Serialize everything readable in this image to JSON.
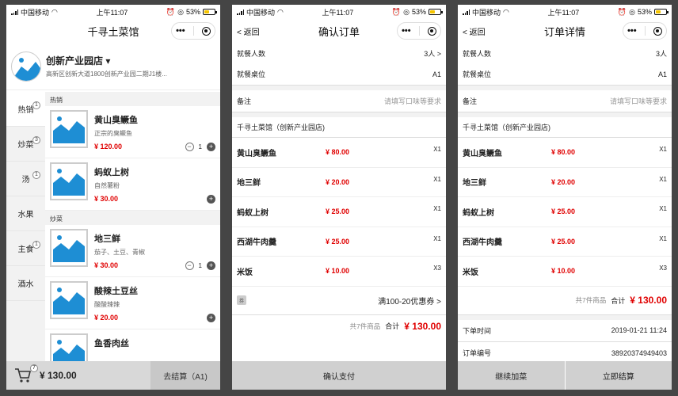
{
  "status": {
    "carrier": "中国移动",
    "time": "上午11:07",
    "battery": "53%",
    "battery_level": 0.53
  },
  "capsule": {
    "more": "•••"
  },
  "colors": {
    "price": "#e00000",
    "background": "#454545",
    "bar": "#d0d0d0"
  },
  "panel1": {
    "title": "千寻土菜馆",
    "store_name": "创新产业园店",
    "store_address": "高新区创新大道1800创新产业园二期J1楼...",
    "categories": [
      {
        "label": "热销",
        "badge": "1"
      },
      {
        "label": "炒菜",
        "badge": "3"
      },
      {
        "label": "汤",
        "badge": "1"
      },
      {
        "label": "水果",
        "badge": ""
      },
      {
        "label": "主食",
        "badge": "1"
      },
      {
        "label": "酒水",
        "badge": ""
      }
    ],
    "sections": [
      {
        "title": "热销",
        "items": [
          {
            "name": "黄山臭鳜鱼",
            "desc": "正宗的臭鳜鱼",
            "price": "¥ 120.00",
            "qty": "1"
          },
          {
            "name": "蚂蚁上树",
            "desc": "自然薯粉",
            "price": "¥ 30.00",
            "qty": ""
          }
        ]
      },
      {
        "title": "炒菜",
        "items": [
          {
            "name": "地三鲜",
            "desc": "茄子、土豆、青椒",
            "price": "¥ 30.00",
            "qty": "1"
          },
          {
            "name": "酸辣土豆丝",
            "desc": "酸酸辣辣",
            "price": "¥ 20.00",
            "qty": ""
          },
          {
            "name": "鱼香肉丝",
            "desc": "",
            "price": "",
            "qty": ""
          }
        ]
      }
    ],
    "cart": {
      "badge": "7",
      "amount": "¥ 130.00",
      "checkout": "去结算（A1)"
    }
  },
  "panel2": {
    "back": "< 返回",
    "title": "确认订单",
    "diners_label": "就餐人数",
    "diners_value": "3人 >",
    "table_label": "就餐桌位",
    "table_value": "A1",
    "remark_label": "备注",
    "remark_placeholder": "请填写口味等要求",
    "store": "千寻土菜馆（创新产业园店)",
    "items": [
      {
        "name": "黄山臭鳜鱼",
        "price": "¥ 80.00",
        "qty": "X1"
      },
      {
        "name": "地三鲜",
        "price": "¥ 20.00",
        "qty": "X1"
      },
      {
        "name": "蚂蚁上树",
        "price": "¥ 25.00",
        "qty": "X1"
      },
      {
        "name": "西湖牛肉羹",
        "price": "¥ 25.00",
        "qty": "X1"
      },
      {
        "name": "米饭",
        "price": "¥ 10.00",
        "qty": "X3"
      }
    ],
    "coupon_tag": "券",
    "coupon": "满100-20优惠券 >",
    "count": "共7件商品",
    "total_label": "合计",
    "total": "¥ 130.00",
    "pay": "确认支付"
  },
  "panel3": {
    "back": "< 返回",
    "title": "订单详情",
    "diners_label": "就餐人数",
    "diners_value": "3人",
    "table_label": "就餐桌位",
    "table_value": "A1",
    "remark_label": "备注",
    "remark_placeholder": "请填写口味等要求",
    "store": "千寻土菜馆（创新产业园店)",
    "items": [
      {
        "name": "黄山臭鳜鱼",
        "price": "¥ 80.00",
        "qty": "X1"
      },
      {
        "name": "地三鲜",
        "price": "¥ 20.00",
        "qty": "X1"
      },
      {
        "name": "蚂蚁上树",
        "price": "¥ 25.00",
        "qty": "X1"
      },
      {
        "name": "西湖牛肉羹",
        "price": "¥ 25.00",
        "qty": "X1"
      },
      {
        "name": "米饭",
        "price": "¥ 10.00",
        "qty": "X3"
      }
    ],
    "count": "共7件商品",
    "total_label": "合计",
    "total": "¥ 130.00",
    "order_time_label": "下单时间",
    "order_time": "2019-01-21 11:24",
    "order_no_label": "订单编号",
    "order_no": "38920374949403",
    "continue": "继续加菜",
    "settle": "立即结算"
  }
}
